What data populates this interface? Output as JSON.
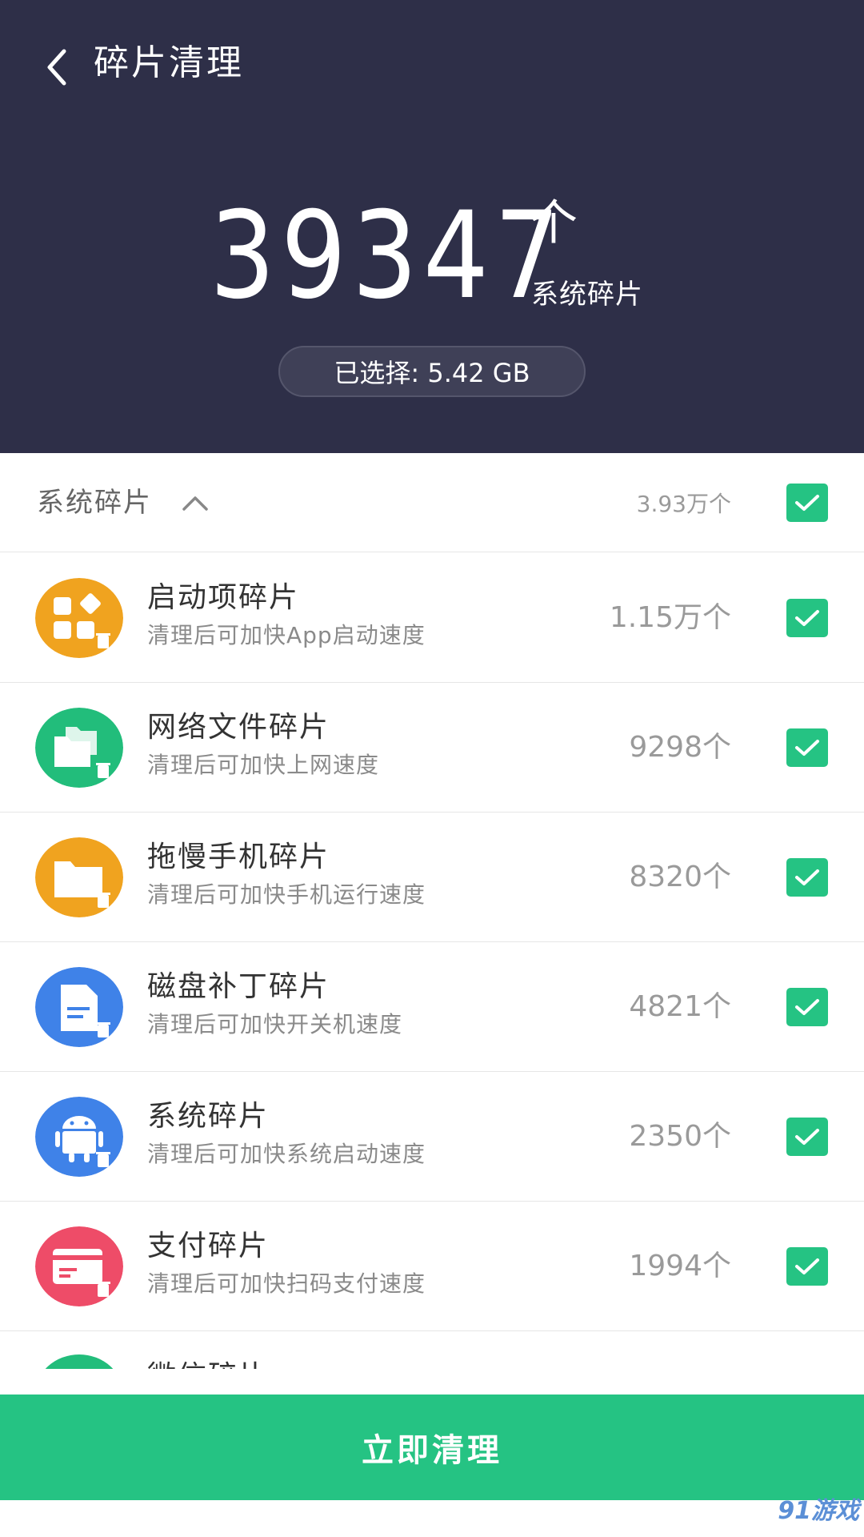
{
  "header": {
    "title": "碎片清理",
    "count": "39347",
    "unit": "个",
    "subtitle": "系统碎片",
    "selected": "已选择: 5.42 GB"
  },
  "section": {
    "title": "系统碎片",
    "count": "3.93万个",
    "checked": true
  },
  "items": [
    {
      "title": "启动项碎片",
      "desc": "清理后可加快App启动速度",
      "count": "1.15万个",
      "icon": "apps-grid-icon",
      "color": "#f0a31f"
    },
    {
      "title": "网络文件碎片",
      "desc": "清理后可加快上网速度",
      "count": "9298个",
      "icon": "folders-icon",
      "color": "#22bd7b"
    },
    {
      "title": "拖慢手机碎片",
      "desc": "清理后可加快手机运行速度",
      "count": "8320个",
      "icon": "folder-icon",
      "color": "#f0a31f"
    },
    {
      "title": "磁盘补丁碎片",
      "desc": "清理后可加快开关机速度",
      "count": "4821个",
      "icon": "document-icon",
      "color": "#3f82e8"
    },
    {
      "title": "系统碎片",
      "desc": "清理后可加快系统启动速度",
      "count": "2350个",
      "icon": "android-icon",
      "color": "#3f82e8"
    },
    {
      "title": "支付碎片",
      "desc": "清理后可加快扫码支付速度",
      "count": "1994个",
      "icon": "card-icon",
      "color": "#ee4c68"
    }
  ],
  "partial_item": {
    "title": "微信碎片"
  },
  "clean_button": "立即清理",
  "watermark": "91游戏"
}
